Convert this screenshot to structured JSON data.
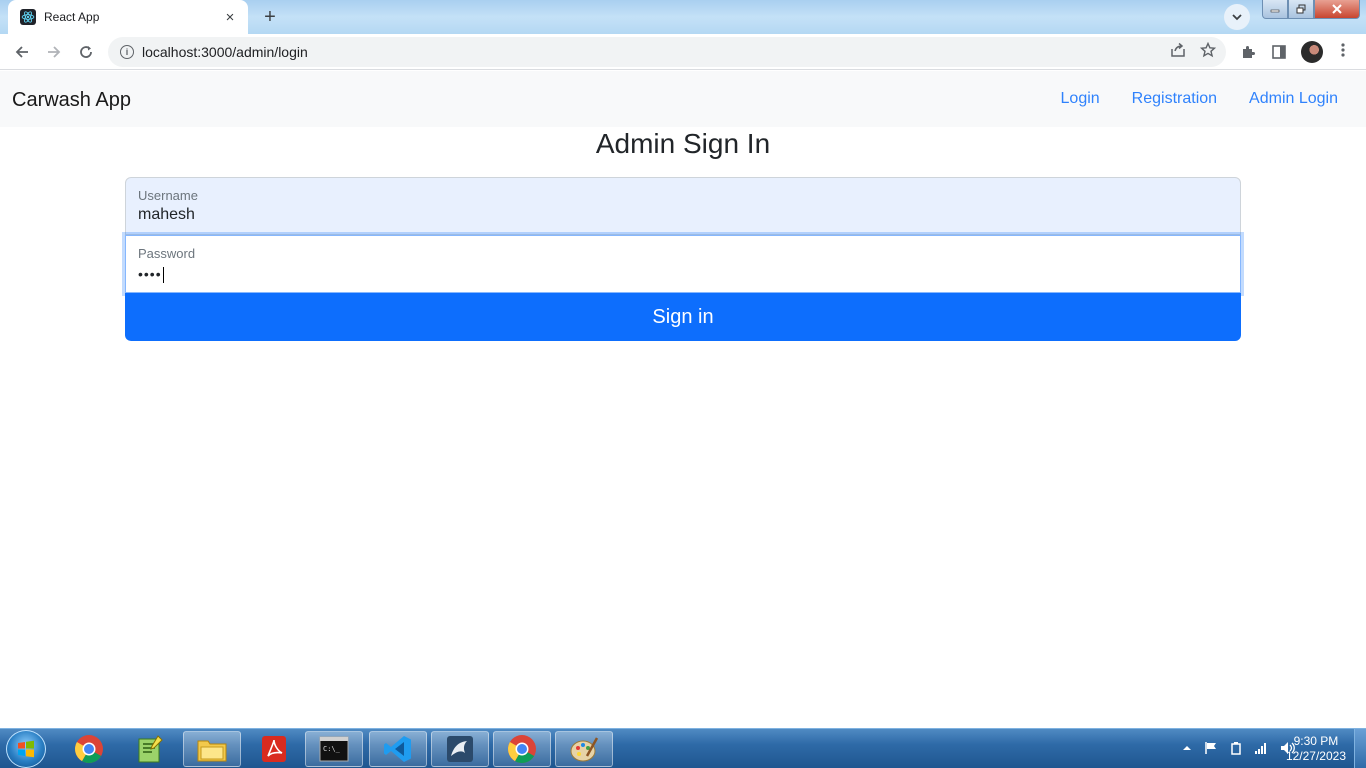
{
  "browser": {
    "tab": {
      "title": "React App",
      "favicon": "react-icon",
      "close": "×"
    },
    "new_tab": "+",
    "url": "localhost:3000/admin/login"
  },
  "app": {
    "brand": "Carwash App",
    "nav": [
      {
        "label": "Login"
      },
      {
        "label": "Registration"
      },
      {
        "label": "Admin Login"
      }
    ]
  },
  "form": {
    "heading": "Admin Sign In",
    "username": {
      "label": "Username",
      "value": "mahesh"
    },
    "password": {
      "label": "Password",
      "value": "••••"
    },
    "submit": "Sign in"
  },
  "taskbar": {
    "apps": [
      {
        "name": "chrome-icon"
      },
      {
        "name": "notepad-plus-icon"
      },
      {
        "name": "file-explorer-icon"
      },
      {
        "name": "acrobat-icon"
      },
      {
        "name": "command-prompt-icon"
      },
      {
        "name": "vscode-icon"
      },
      {
        "name": "mysql-workbench-icon"
      },
      {
        "name": "chrome-icon",
        "active": true
      },
      {
        "name": "paint-icon"
      }
    ],
    "time": "9:30 PM",
    "date": "12/27/2023"
  },
  "colors": {
    "primary": "#0d6efd",
    "navbar_bg": "#f8f9fa",
    "autofill_bg": "#e8f0fe"
  }
}
